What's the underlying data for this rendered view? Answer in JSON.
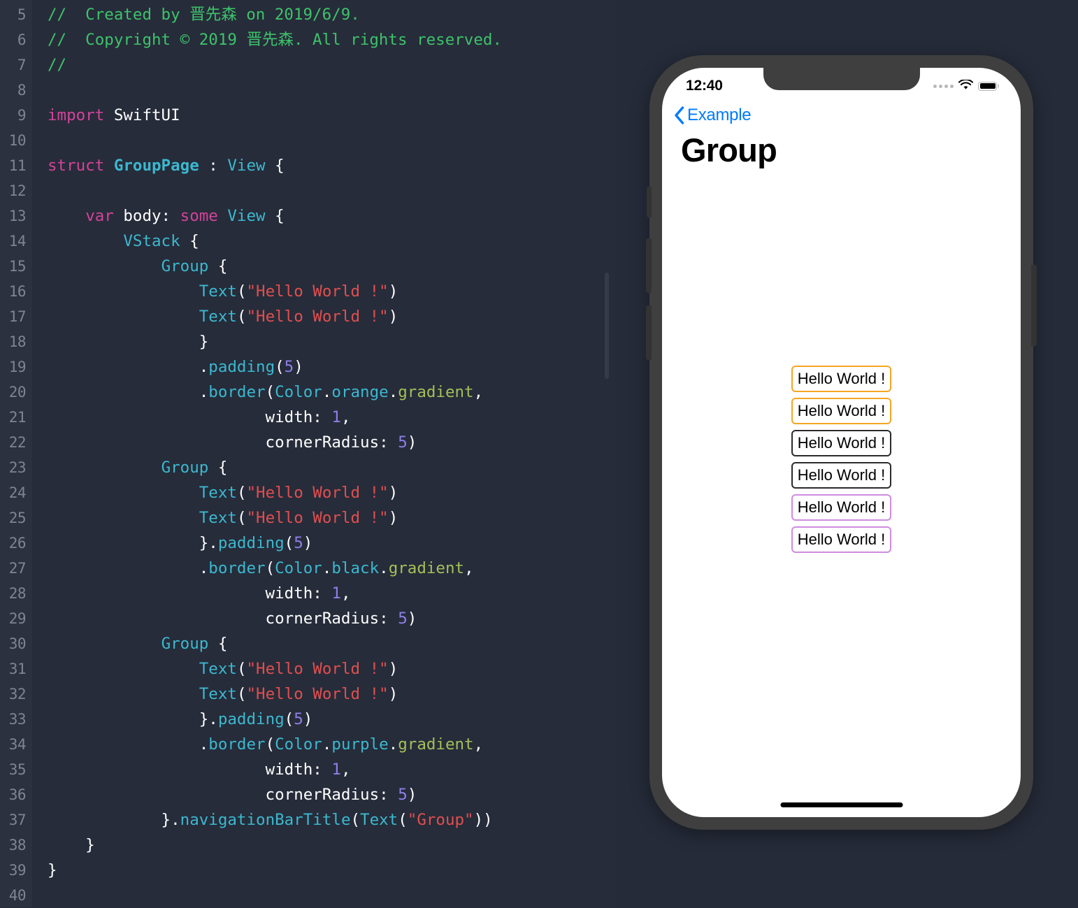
{
  "editor": {
    "language": "Swift",
    "first_line_number": 5,
    "lines": [
      {
        "n": 5,
        "tokens": [
          {
            "t": "//  Created by 晋先森 on 2019/6/9.",
            "c": "cmt"
          }
        ]
      },
      {
        "n": 6,
        "tokens": [
          {
            "t": "//  Copyright © 2019 晋先森. All rights reserved.",
            "c": "cmt"
          }
        ]
      },
      {
        "n": 7,
        "tokens": [
          {
            "t": "//",
            "c": "cmt"
          }
        ]
      },
      {
        "n": 8,
        "tokens": []
      },
      {
        "n": 9,
        "tokens": [
          {
            "t": "import",
            "c": "kw"
          },
          {
            "t": " SwiftUI",
            "c": "pun"
          }
        ]
      },
      {
        "n": 10,
        "tokens": []
      },
      {
        "n": 11,
        "tokens": [
          {
            "t": "struct",
            "c": "kw"
          },
          {
            "t": " ",
            "c": "pun"
          },
          {
            "t": "GroupPage",
            "c": "typb"
          },
          {
            "t": " : ",
            "c": "pun"
          },
          {
            "t": "View",
            "c": "typ"
          },
          {
            "t": " {",
            "c": "pun"
          }
        ]
      },
      {
        "n": 12,
        "tokens": []
      },
      {
        "n": 13,
        "tokens": [
          {
            "t": "    ",
            "c": "pun"
          },
          {
            "t": "var",
            "c": "kw"
          },
          {
            "t": " body: ",
            "c": "pun"
          },
          {
            "t": "some",
            "c": "kw"
          },
          {
            "t": " ",
            "c": "pun"
          },
          {
            "t": "View",
            "c": "typ"
          },
          {
            "t": " {",
            "c": "pun"
          }
        ]
      },
      {
        "n": 14,
        "tokens": [
          {
            "t": "        ",
            "c": "pun"
          },
          {
            "t": "VStack",
            "c": "typ"
          },
          {
            "t": " {",
            "c": "pun"
          }
        ]
      },
      {
        "n": 15,
        "tokens": [
          {
            "t": "            ",
            "c": "pun"
          },
          {
            "t": "Group",
            "c": "typ"
          },
          {
            "t": " {",
            "c": "pun"
          }
        ]
      },
      {
        "n": 16,
        "tokens": [
          {
            "t": "                ",
            "c": "pun"
          },
          {
            "t": "Text",
            "c": "typ"
          },
          {
            "t": "(",
            "c": "pun"
          },
          {
            "t": "\"Hello World !\"",
            "c": "str"
          },
          {
            "t": ")",
            "c": "pun"
          }
        ]
      },
      {
        "n": 17,
        "tokens": [
          {
            "t": "                ",
            "c": "pun"
          },
          {
            "t": "Text",
            "c": "typ"
          },
          {
            "t": "(",
            "c": "pun"
          },
          {
            "t": "\"Hello World !\"",
            "c": "str"
          },
          {
            "t": ")",
            "c": "pun"
          }
        ]
      },
      {
        "n": 18,
        "tokens": [
          {
            "t": "                }",
            "c": "pun"
          }
        ]
      },
      {
        "n": 19,
        "tokens": [
          {
            "t": "                .",
            "c": "pun"
          },
          {
            "t": "padding",
            "c": "prop"
          },
          {
            "t": "(",
            "c": "pun"
          },
          {
            "t": "5",
            "c": "num"
          },
          {
            "t": ")",
            "c": "pun"
          }
        ]
      },
      {
        "n": 20,
        "tokens": [
          {
            "t": "                .",
            "c": "pun"
          },
          {
            "t": "border",
            "c": "prop"
          },
          {
            "t": "(",
            "c": "pun"
          },
          {
            "t": "Color",
            "c": "typ"
          },
          {
            "t": ".",
            "c": "pun"
          },
          {
            "t": "orange",
            "c": "typ"
          },
          {
            "t": ".",
            "c": "pun"
          },
          {
            "t": "gradient",
            "c": "grad"
          },
          {
            "t": ",",
            "c": "pun"
          }
        ]
      },
      {
        "n": 21,
        "tokens": [
          {
            "t": "                       width: ",
            "c": "pun"
          },
          {
            "t": "1",
            "c": "num"
          },
          {
            "t": ",",
            "c": "pun"
          }
        ]
      },
      {
        "n": 22,
        "tokens": [
          {
            "t": "                       cornerRadius: ",
            "c": "pun"
          },
          {
            "t": "5",
            "c": "num"
          },
          {
            "t": ")",
            "c": "pun"
          }
        ]
      },
      {
        "n": 23,
        "tokens": [
          {
            "t": "            ",
            "c": "pun"
          },
          {
            "t": "Group",
            "c": "typ"
          },
          {
            "t": " {",
            "c": "pun"
          }
        ]
      },
      {
        "n": 24,
        "tokens": [
          {
            "t": "                ",
            "c": "pun"
          },
          {
            "t": "Text",
            "c": "typ"
          },
          {
            "t": "(",
            "c": "pun"
          },
          {
            "t": "\"Hello World !\"",
            "c": "str"
          },
          {
            "t": ")",
            "c": "pun"
          }
        ]
      },
      {
        "n": 25,
        "tokens": [
          {
            "t": "                ",
            "c": "pun"
          },
          {
            "t": "Text",
            "c": "typ"
          },
          {
            "t": "(",
            "c": "pun"
          },
          {
            "t": "\"Hello World !\"",
            "c": "str"
          },
          {
            "t": ")",
            "c": "pun"
          }
        ]
      },
      {
        "n": 26,
        "tokens": [
          {
            "t": "                }.",
            "c": "pun"
          },
          {
            "t": "padding",
            "c": "prop"
          },
          {
            "t": "(",
            "c": "pun"
          },
          {
            "t": "5",
            "c": "num"
          },
          {
            "t": ")",
            "c": "pun"
          }
        ]
      },
      {
        "n": 27,
        "tokens": [
          {
            "t": "                .",
            "c": "pun"
          },
          {
            "t": "border",
            "c": "prop"
          },
          {
            "t": "(",
            "c": "pun"
          },
          {
            "t": "Color",
            "c": "typ"
          },
          {
            "t": ".",
            "c": "pun"
          },
          {
            "t": "black",
            "c": "typ"
          },
          {
            "t": ".",
            "c": "pun"
          },
          {
            "t": "gradient",
            "c": "grad"
          },
          {
            "t": ",",
            "c": "pun"
          }
        ]
      },
      {
        "n": 28,
        "tokens": [
          {
            "t": "                       width: ",
            "c": "pun"
          },
          {
            "t": "1",
            "c": "num"
          },
          {
            "t": ",",
            "c": "pun"
          }
        ]
      },
      {
        "n": 29,
        "tokens": [
          {
            "t": "                       cornerRadius: ",
            "c": "pun"
          },
          {
            "t": "5",
            "c": "num"
          },
          {
            "t": ")",
            "c": "pun"
          }
        ]
      },
      {
        "n": 30,
        "tokens": [
          {
            "t": "            ",
            "c": "pun"
          },
          {
            "t": "Group",
            "c": "typ"
          },
          {
            "t": " {",
            "c": "pun"
          }
        ]
      },
      {
        "n": 31,
        "tokens": [
          {
            "t": "                ",
            "c": "pun"
          },
          {
            "t": "Text",
            "c": "typ"
          },
          {
            "t": "(",
            "c": "pun"
          },
          {
            "t": "\"Hello World !\"",
            "c": "str"
          },
          {
            "t": ")",
            "c": "pun"
          }
        ]
      },
      {
        "n": 32,
        "tokens": [
          {
            "t": "                ",
            "c": "pun"
          },
          {
            "t": "Text",
            "c": "typ"
          },
          {
            "t": "(",
            "c": "pun"
          },
          {
            "t": "\"Hello World !\"",
            "c": "str"
          },
          {
            "t": ")",
            "c": "pun"
          }
        ]
      },
      {
        "n": 33,
        "tokens": [
          {
            "t": "                }.",
            "c": "pun"
          },
          {
            "t": "padding",
            "c": "prop"
          },
          {
            "t": "(",
            "c": "pun"
          },
          {
            "t": "5",
            "c": "num"
          },
          {
            "t": ")",
            "c": "pun"
          }
        ]
      },
      {
        "n": 34,
        "tokens": [
          {
            "t": "                .",
            "c": "pun"
          },
          {
            "t": "border",
            "c": "prop"
          },
          {
            "t": "(",
            "c": "pun"
          },
          {
            "t": "Color",
            "c": "typ"
          },
          {
            "t": ".",
            "c": "pun"
          },
          {
            "t": "purple",
            "c": "typ"
          },
          {
            "t": ".",
            "c": "pun"
          },
          {
            "t": "gradient",
            "c": "grad"
          },
          {
            "t": ",",
            "c": "pun"
          }
        ]
      },
      {
        "n": 35,
        "tokens": [
          {
            "t": "                       width: ",
            "c": "pun"
          },
          {
            "t": "1",
            "c": "num"
          },
          {
            "t": ",",
            "c": "pun"
          }
        ]
      },
      {
        "n": 36,
        "tokens": [
          {
            "t": "                       cornerRadius: ",
            "c": "pun"
          },
          {
            "t": "5",
            "c": "num"
          },
          {
            "t": ")",
            "c": "pun"
          }
        ]
      },
      {
        "n": 37,
        "tokens": [
          {
            "t": "            }.",
            "c": "pun"
          },
          {
            "t": "navigationBarTitle",
            "c": "prop"
          },
          {
            "t": "(",
            "c": "pun"
          },
          {
            "t": "Text",
            "c": "typ"
          },
          {
            "t": "(",
            "c": "pun"
          },
          {
            "t": "\"Group\"",
            "c": "str"
          },
          {
            "t": "))",
            "c": "pun"
          }
        ]
      },
      {
        "n": 38,
        "tokens": [
          {
            "t": "    }",
            "c": "pun"
          }
        ]
      },
      {
        "n": 39,
        "tokens": [
          {
            "t": "}",
            "c": "pun"
          }
        ]
      },
      {
        "n": 40,
        "tokens": []
      }
    ],
    "colors": {
      "background": "#262c3a",
      "gutter_background": "#2b313f",
      "line_number": "#7d8595",
      "comment": "#3ec26a",
      "keyword": "#d4439a",
      "type": "#3cb8cf",
      "string": "#e04f4f",
      "number": "#8f7ee8",
      "gradient_member": "#a3c057",
      "plain": "#ffffff"
    }
  },
  "preview": {
    "device": "iPhone",
    "status_bar": {
      "time": "12:40",
      "signal_icon": "signal-dots-icon",
      "wifi_icon": "wifi-icon",
      "battery_icon": "battery-full-icon"
    },
    "nav_bar": {
      "back_icon": "chevron-left-icon",
      "back_label": "Example",
      "title": "Group"
    },
    "boxes": [
      {
        "label": "Hello World !",
        "border": "orange",
        "color": "#f5a623"
      },
      {
        "label": "Hello World !",
        "border": "orange",
        "color": "#f5a623"
      },
      {
        "label": "Hello World !",
        "border": "black",
        "color": "#2b2b2b"
      },
      {
        "label": "Hello World !",
        "border": "black",
        "color": "#2b2b2b"
      },
      {
        "label": "Hello World !",
        "border": "purple",
        "color": "#cf8ce0"
      },
      {
        "label": "Hello World !",
        "border": "purple",
        "color": "#cf8ce0"
      }
    ],
    "home_indicator": true,
    "accent_color": "#007aff"
  }
}
